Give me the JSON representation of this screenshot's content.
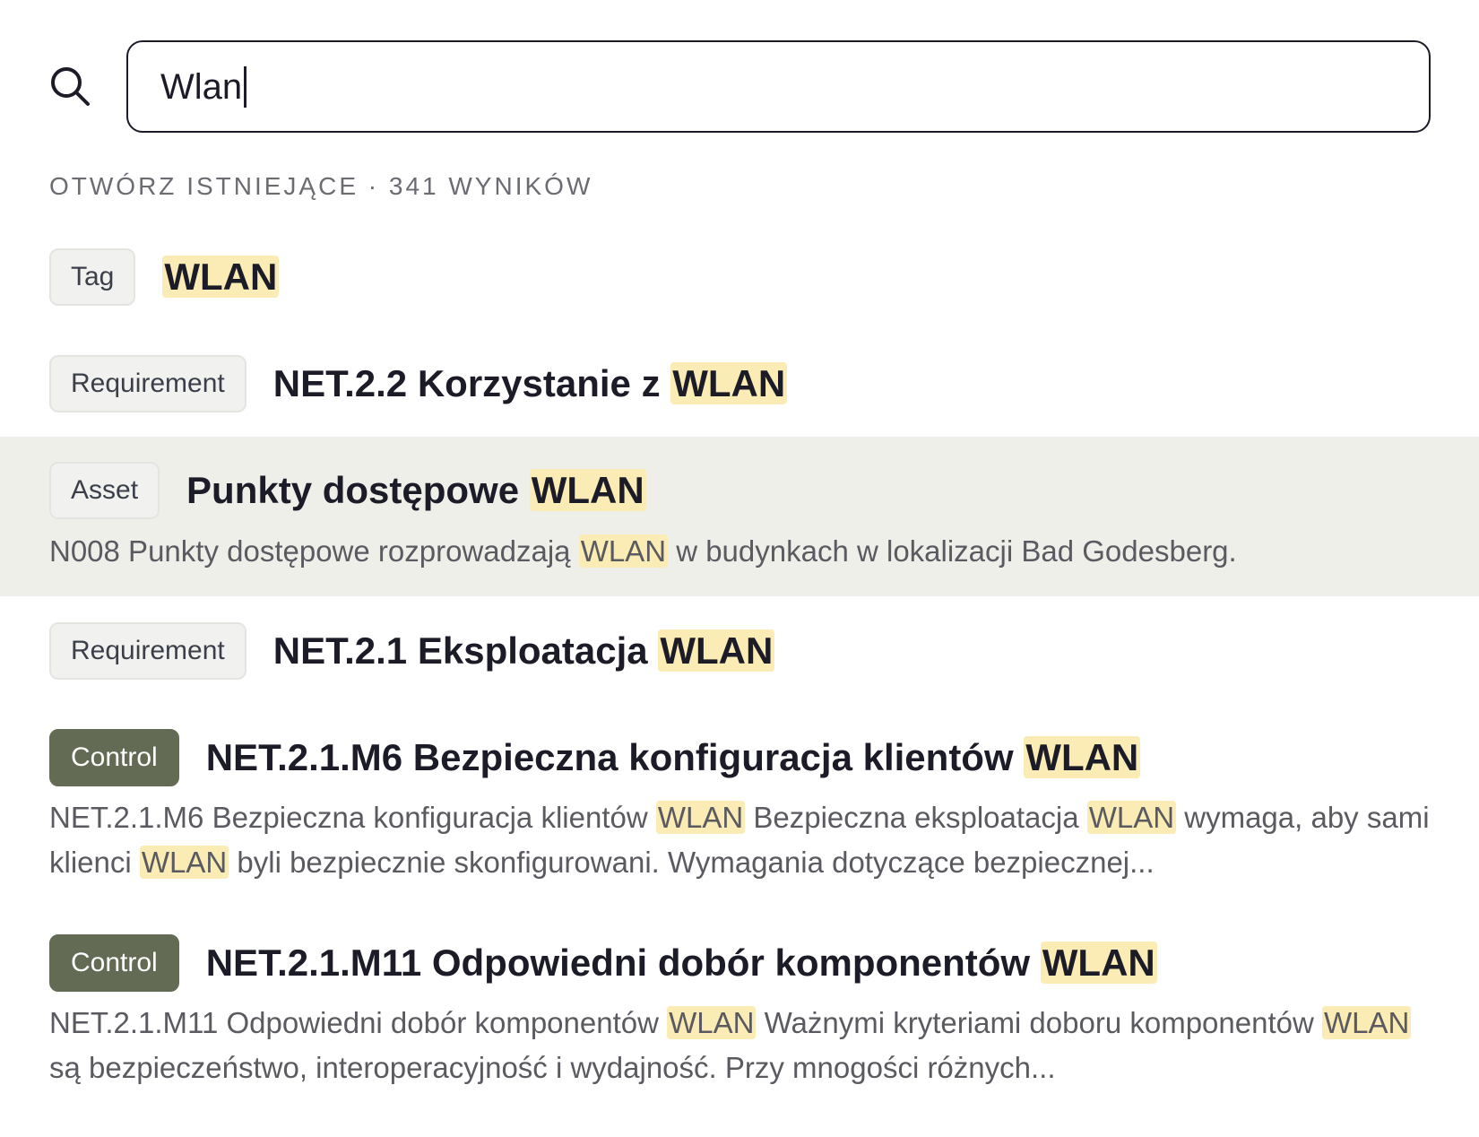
{
  "search": {
    "value": "Wlan",
    "icon": "search-icon"
  },
  "section": {
    "label": "OTWÓRZ ISTNIEJĄCE · 341 WYNIKÓW"
  },
  "colors": {
    "highlight": "#faecb4",
    "selected_row": "#efefea",
    "control_badge": "#636b55"
  },
  "results": [
    {
      "badge": "Tag",
      "title_pre": "",
      "title_match": "WLAN",
      "desc": []
    },
    {
      "badge": "Requirement",
      "title_pre": "NET.2.2 Korzystanie z ",
      "title_match": "WLAN",
      "desc": []
    },
    {
      "badge": "Asset",
      "title_pre": "Punkty dostępowe ",
      "title_match": "WLAN",
      "selected": true,
      "desc": [
        "N008 Punkty dostępowe rozprowadzają ",
        "WLAN",
        " w budynkach w lokalizacji Bad Godesberg."
      ]
    },
    {
      "badge": "Requirement",
      "title_pre": "NET.2.1 Eksploatacja ",
      "title_match": "WLAN",
      "desc": []
    },
    {
      "badge": "Control",
      "title_pre": "NET.2.1.M6 Bezpieczna konfiguracja klientów ",
      "title_match": "WLAN",
      "desc": [
        "NET.2.1.M6 Bezpieczna konfiguracja klientów ",
        "WLAN",
        " Bezpieczna eksploatacja ",
        "WLAN",
        " wymaga, aby sami klienci ",
        "WLAN",
        " byli bezpiecznie skonfigurowani. Wymagania dotyczące bezpiecznej..."
      ]
    },
    {
      "badge": "Control",
      "title_pre": "NET.2.1.M11 Odpowiedni dobór komponentów ",
      "title_match": "WLAN",
      "desc": [
        "NET.2.1.M11 Odpowiedni dobór komponentów ",
        "WLAN",
        " Ważnymi kryteriami doboru komponentów ",
        "WLAN",
        " są bezpieczeństwo, interoperacyjność i wydajność. Przy mnogości różnych..."
      ]
    }
  ]
}
